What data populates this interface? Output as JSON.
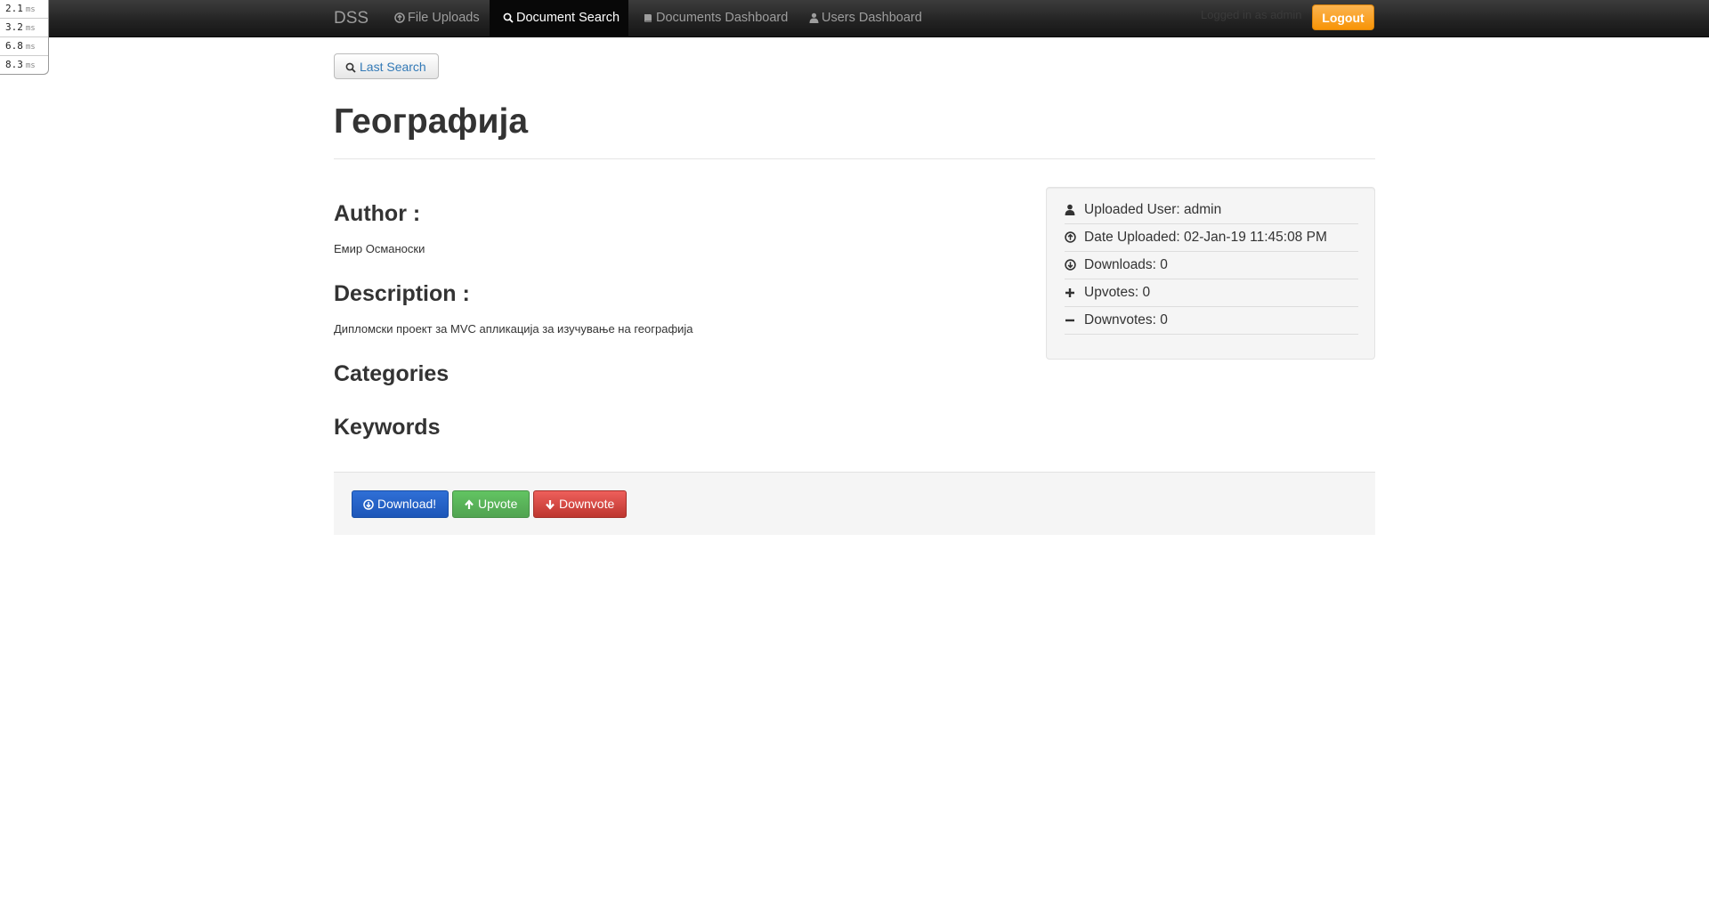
{
  "timing": [
    {
      "value": "2.1",
      "unit": "ms"
    },
    {
      "value": "3.2",
      "unit": "ms"
    },
    {
      "value": "6.8",
      "unit": "ms"
    },
    {
      "value": "8.3",
      "unit": "ms"
    }
  ],
  "navbar": {
    "brand": "DSS",
    "items": [
      {
        "label": "File Uploads",
        "icon": "arrow-circle-up-icon"
      },
      {
        "label": "Document Search",
        "icon": "search-icon",
        "active": true
      },
      {
        "label": "Documents Dashboard",
        "icon": "book-icon"
      },
      {
        "label": "Users Dashboard",
        "icon": "user-icon"
      }
    ],
    "login_text": "Logged in as admin",
    "logout_label": "Logout"
  },
  "last_search_label": "Last Search",
  "document": {
    "title": "Географија",
    "author_heading": "Author :",
    "author": "Емир Османоски",
    "description_heading": "Description :",
    "description": "Дипломски проект за MVC апликација за изучување на географија",
    "categories_heading": "Categories",
    "keywords_heading": "Keywords"
  },
  "info": {
    "uploaded_user": "Uploaded User: admin",
    "date_uploaded": "Date Uploaded: 02-Jan-19 11:45:08 PM",
    "downloads": "Downloads: 0",
    "upvotes": "Upvotes: 0",
    "downvotes": "Downvotes: 0"
  },
  "actions": {
    "download_label": "Download!",
    "upvote_label": "Upvote",
    "downvote_label": "Downvote"
  },
  "colors": {
    "logout": "#f89406",
    "download": "#1d56b8",
    "upvote": "#51a351",
    "downvote": "#bd362f"
  }
}
